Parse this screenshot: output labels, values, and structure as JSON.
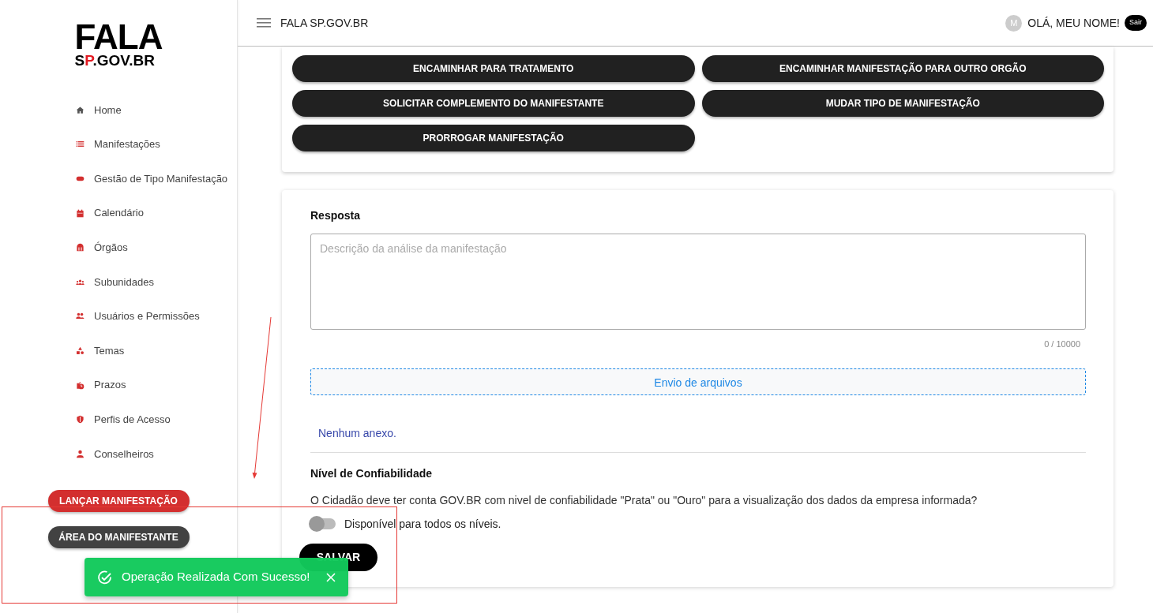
{
  "logo": {
    "title": "FALA",
    "subtitle": "SP.GOV.BR"
  },
  "sidebar": {
    "items": [
      {
        "label": "Home",
        "selected": false
      },
      {
        "label": "Manifestações",
        "selected": false
      },
      {
        "label": "Gestão de Tipo Manifestação",
        "selected": false
      },
      {
        "label": "Calendário",
        "selected": false
      },
      {
        "label": "Órgãos",
        "selected": false
      },
      {
        "label": "Subunidades",
        "selected": false
      },
      {
        "label": "Usuários e Permissões",
        "selected": false
      },
      {
        "label": "Temas",
        "selected": false
      },
      {
        "label": "Prazos",
        "selected": false
      },
      {
        "label": "Perfis de Acesso",
        "selected": false
      },
      {
        "label": "Conselheiros",
        "selected": false
      }
    ],
    "buttons": [
      {
        "label": "LANÇAR MANIFESTAÇÃO",
        "kind": "primary"
      },
      {
        "label": "ÁREA DO MANIFESTANTE",
        "kind": "secondary"
      }
    ]
  },
  "header": {
    "title": "FALA SP.GOV.BR",
    "avatar": "M",
    "greeting": "OLÁ, MEU NOME!",
    "logout": "Sair"
  },
  "actions": [
    "ENCAMINHAR PARA TRATAMENTO",
    "ENCAMINHAR MANIFESTAÇÃO PARA OUTRO ORGÃO",
    "SOLICITAR COMPLEMENTO DO MANIFESTANTE",
    "MUDAR TIPO DE MANIFESTAÇÃO",
    "PRORROGAR MANIFESTAÇÃO"
  ],
  "response": {
    "label": "Resposta",
    "placeholder": "Descrição da análise da manifestação",
    "counter": "0 / 10000",
    "upload": "Envio de arquivos",
    "attachments": "Nenhum anexo."
  },
  "reliability": {
    "title": "Nível de Confiabilidade",
    "question": "O Cidadão deve ter conta GOV.BR com nivel de confiabilidade \"Prata\" ou \"Ouro\" para a visualização dos dados da empresa informada?",
    "toggle": {
      "on": false,
      "label": "Disponível para todos os níveis."
    }
  },
  "save": "SALVAR",
  "toast": {
    "message": "Operação Realizada Com Sucesso!",
    "kind": "success"
  },
  "annotations": [
    {
      "kind": "arrow"
    },
    {
      "kind": "rectangle"
    }
  ]
}
